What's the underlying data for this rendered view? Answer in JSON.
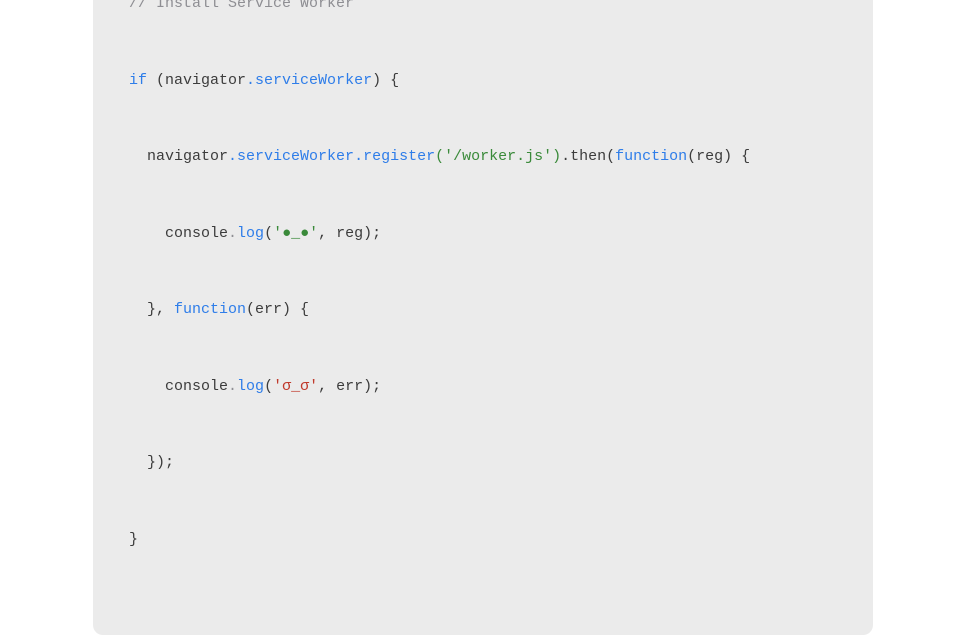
{
  "code": {
    "comment": "// Install Service Worker",
    "line1_kw": "if",
    "line1_rest": " (navigator",
    "line1_prop": ".serviceWorker",
    "line1_end": ") {",
    "line2_indent": "  navigator",
    "line2_prop1": ".serviceWorker",
    "line2_method": ".register",
    "line2_string": "('/worker.js')",
    "line2_chain": ".then(",
    "line2_func_kw": "function",
    "line2_func_arg": "(reg)",
    "line2_brace": " {",
    "line3_indent": "    console",
    "line3_dot": ".",
    "line3_log": "log",
    "line3_str_green": "('●_●'",
    "line3_comma": ",",
    "line3_var": " reg);",
    "line4_indent": "  }, ",
    "line4_func_kw": "function",
    "line4_func_arg": "(err)",
    "line4_brace": " {",
    "line5_indent": "    console",
    "line5_dot": ".",
    "line5_log": "log",
    "line5_str_red": "('σ_σ'",
    "line5_comma": ",",
    "line5_var": " err);",
    "line6_indent": "  });",
    "line7": "}"
  }
}
